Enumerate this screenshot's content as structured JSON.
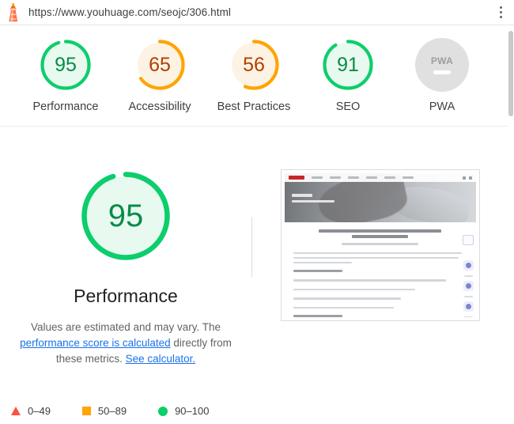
{
  "topbar": {
    "icon": "lighthouse-icon",
    "url": "https://www.youhuage.com/seojc/306.html",
    "menu_icon": "kebab-menu-icon"
  },
  "colors": {
    "green": "#0cce6b",
    "green_text": "#0b8a4a",
    "green_fill": "#e8f9f0",
    "orange": "#ffa400",
    "orange_text": "#b33f00",
    "orange_fill": "#fdf3e4",
    "red": "#ff4e42",
    "gray": "#e0e0e0",
    "link": "#1a73e8"
  },
  "summary": {
    "gauges": [
      {
        "label": "Performance",
        "score": 95,
        "rating": "pass",
        "color": "#0cce6b",
        "text_color": "#0b8a4a",
        "fill": "#e8f9f0"
      },
      {
        "label": "Accessibility",
        "score": 65,
        "rating": "average",
        "color": "#ffa400",
        "text_color": "#b33f00",
        "fill": "#fdf3e4"
      },
      {
        "label": "Best Practices",
        "score": 56,
        "rating": "average",
        "color": "#ffa400",
        "text_color": "#b33f00",
        "fill": "#fdf3e4"
      },
      {
        "label": "SEO",
        "score": 91,
        "rating": "pass",
        "color": "#0cce6b",
        "text_color": "#0b8a4a",
        "fill": "#e8f9f0"
      }
    ],
    "pwa": {
      "label": "PWA",
      "badge_text": "PWA",
      "score": null,
      "rating": "null"
    }
  },
  "detail": {
    "score": 95,
    "title": "Performance",
    "description_part1": "Values are estimated and may vary. The ",
    "link1": "performance score is calculated",
    "description_part2": " directly from these metrics. ",
    "link2": "See calculator.",
    "screenshot_alt": "final-screenshot"
  },
  "legend": [
    {
      "icon": "triangle-icon",
      "range": "0–49",
      "color": "#ff4e42"
    },
    {
      "icon": "square-icon",
      "range": "50–89",
      "color": "#ffa400"
    },
    {
      "icon": "circle-icon",
      "range": "90–100",
      "color": "#0cce6b"
    }
  ]
}
